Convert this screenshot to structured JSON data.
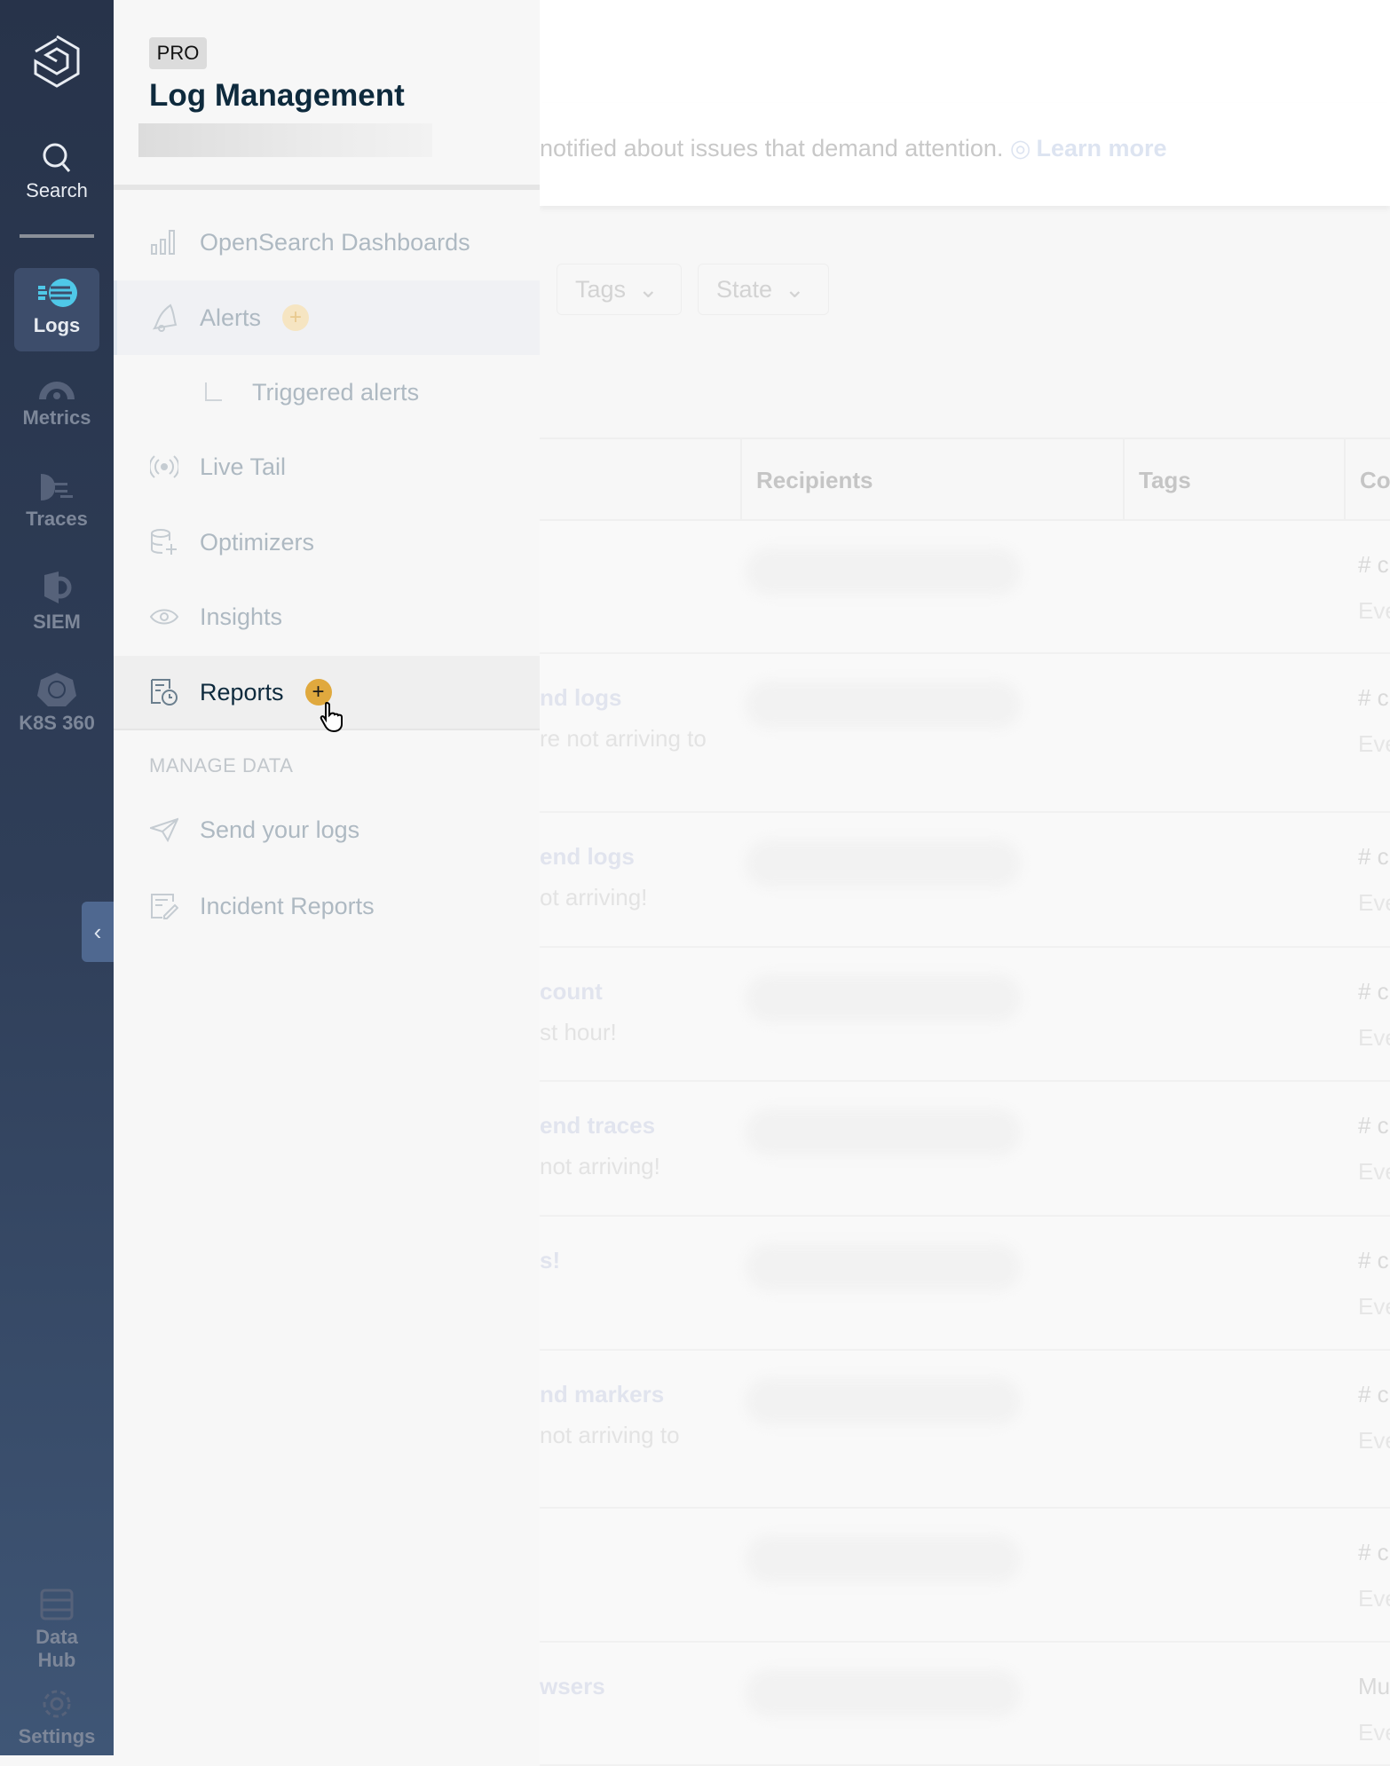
{
  "rail": {
    "items": [
      {
        "label": "Search",
        "icon": "search-icon"
      },
      {
        "label": "Logs",
        "icon": "logs-icon",
        "active": true
      },
      {
        "label": "Metrics",
        "icon": "gauge-icon"
      },
      {
        "label": "Traces",
        "icon": "traces-icon"
      },
      {
        "label": "SIEM",
        "icon": "shield-icon"
      },
      {
        "label": "K8S 360",
        "icon": "helm-icon"
      },
      {
        "label": "Data Hub",
        "icon": "data-hub-icon"
      },
      {
        "label": "Settings",
        "icon": "gear-icon"
      }
    ],
    "collapse_glyph": "‹"
  },
  "panel": {
    "badge": "PRO",
    "title": "Log Management",
    "items": [
      {
        "label": "OpenSearch Dashboards",
        "icon": "bar-chart-icon"
      },
      {
        "label": "Alerts",
        "icon": "bell-icon",
        "plus": "+"
      },
      {
        "label": "Triggered alerts",
        "icon": "tree-branch-icon"
      },
      {
        "label": "Live Tail",
        "icon": "broadcast-icon"
      },
      {
        "label": "Optimizers",
        "icon": "database-plus-icon"
      },
      {
        "label": "Insights",
        "icon": "eye-icon"
      },
      {
        "label": "Reports",
        "icon": "report-clock-icon",
        "plus": "+"
      }
    ],
    "section": "MANAGE DATA",
    "manage_items": [
      {
        "label": "Send your logs",
        "icon": "paper-plane-icon"
      },
      {
        "label": "Incident Reports",
        "icon": "edit-document-icon"
      }
    ]
  },
  "main": {
    "banner_text": "notified about issues that demand attention.",
    "learn_more": "Learn more",
    "filters": [
      "Tags",
      "State"
    ],
    "columns": [
      "Recipients",
      "Tags",
      "Co"
    ],
    "rows": [
      {
        "title": "",
        "sub": "",
        "c1": "# c",
        "c2": "Eve"
      },
      {
        "title": "nd logs",
        "sub": "re not arriving to",
        "c1": "# c",
        "c2": "Eve"
      },
      {
        "title": "end logs",
        "sub": "ot arriving!",
        "c1": "# c",
        "c2": "Eve"
      },
      {
        "title": "count",
        "sub": "st hour!",
        "c1": "# c",
        "c2": "Eve"
      },
      {
        "title": "end traces",
        "sub": " not arriving!",
        "c1": "# c",
        "c2": "Eve"
      },
      {
        "title": "s!",
        "sub": "",
        "c1": "# c",
        "c2": "Eve"
      },
      {
        "title": "nd markers",
        "sub": " not arriving to",
        "c1": "# c",
        "c2": "Eve"
      },
      {
        "title": "",
        "sub": "",
        "c1": "# c",
        "c2": "Eve"
      },
      {
        "title": "wsers",
        "sub": "",
        "c1": "Mu",
        "c2": "Eve"
      }
    ]
  },
  "colors": {
    "rail": "#27334a",
    "accent_plus": "#e0a93e",
    "title": "#0e2a3d",
    "logs_icon": "#4fc8e8"
  }
}
